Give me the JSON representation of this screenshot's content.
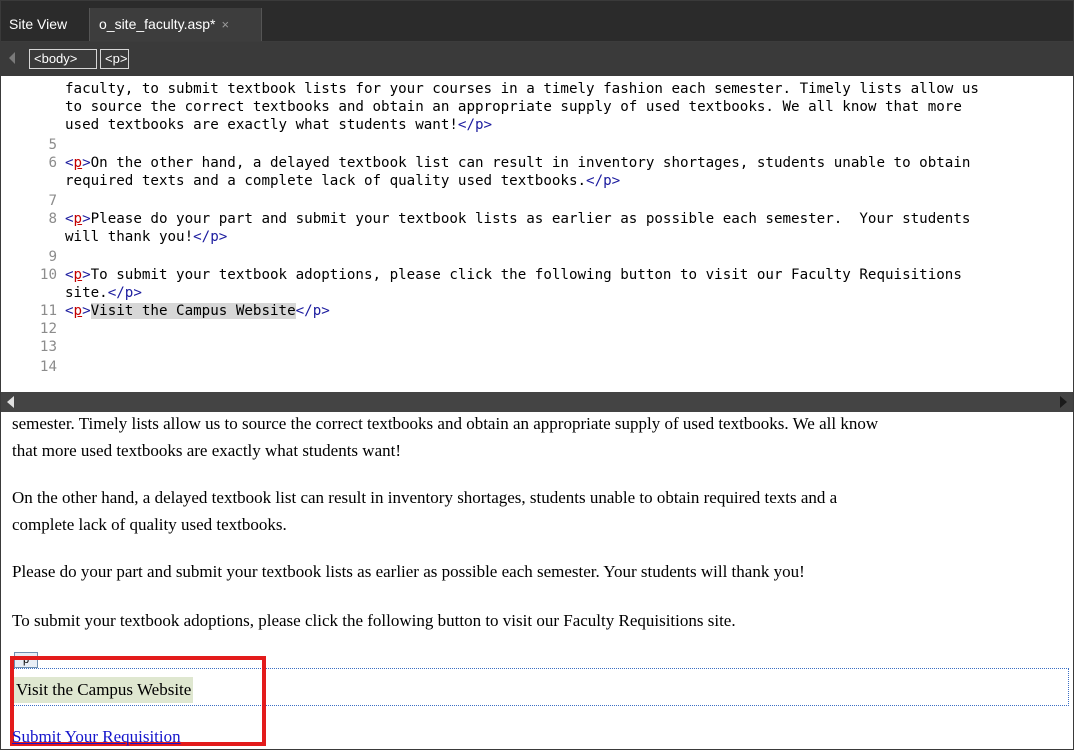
{
  "tabs": {
    "site_view": "Site View",
    "file": "o_site_faculty.asp*",
    "close": "×"
  },
  "tag_selector": {
    "body": "<body>",
    "p": "<p>"
  },
  "code_lines": {
    "l1": "faculty, to submit textbook lists for your courses in a timely fashion each semester. Timely lists allow us",
    "l2": "to source the correct textbooks and obtain an appropriate supply of used textbooks. We all know that more",
    "l3_text": "used textbooks are exactly what students want!",
    "n5": "5",
    "n6": "6",
    "l6_text": "On the other hand, a delayed textbook list can result in inventory shortages, students unable to obtain",
    "l6b_text": "required texts and a complete lack of quality used textbooks.",
    "n7": "7",
    "n8": "8",
    "l8_text": "Please do your part and submit your textbook lists as earlier as possible each semester.  Your students",
    "l8b_text": "will thank you!",
    "n9": "9",
    "n10": "10",
    "l10_text": "To submit your textbook adoptions, please click the following button to visit our Faculty Requisitions",
    "l10b_text": "site.",
    "n11": "11",
    "l11_text": "Visit the Campus Website",
    "n12": "12",
    "n13": "13",
    "n14": "14",
    "open_tag_lt": "<",
    "open_tag_p": "p",
    "open_tag_gt": ">",
    "close_tag": "</p>"
  },
  "design": {
    "line1": "semester. Timely lists allow us to source the correct textbooks and obtain an appropriate supply of used textbooks. We all know",
    "line2": "that more used textbooks are exactly what students want!",
    "line3": "On the other hand, a delayed textbook list can result in inventory shortages, students unable to obtain required texts and a",
    "line4": "complete lack of quality used textbooks.",
    "line5": "Please do your part and submit your textbook lists as earlier as possible each semester. Your students will thank you!",
    "line6": "To submit your textbook adoptions, please click the following button to visit our Faculty Requisitions site.",
    "p_label": "p",
    "visit": "Visit the Campus Website",
    "submit_link": "Submit Your Requisition"
  },
  "colors": {
    "highlight_box": "#e31b1b",
    "tag_color": "#1b1b9e",
    "p_tag_color": "#c40000",
    "link_color": "#1515cc"
  }
}
